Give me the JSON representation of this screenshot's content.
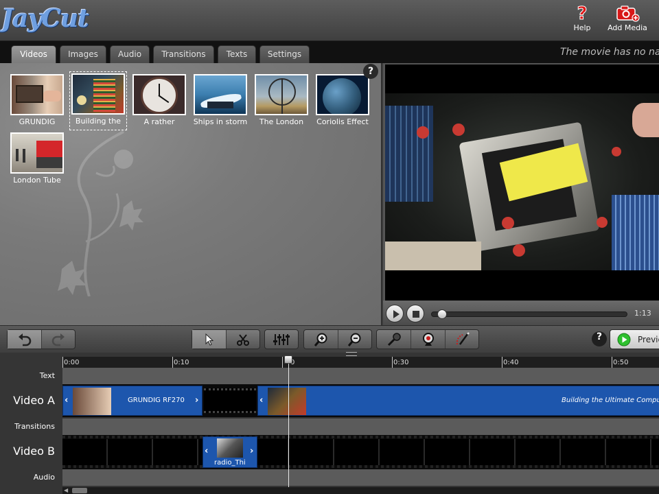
{
  "header": {
    "logo_text": "JayCut",
    "help_label": "Help",
    "add_media_label": "Add Media"
  },
  "tabs": [
    {
      "label": "Videos",
      "active": true
    },
    {
      "label": "Images",
      "active": false
    },
    {
      "label": "Audio",
      "active": false
    },
    {
      "label": "Transitions",
      "active": false
    },
    {
      "label": "Texts",
      "active": false
    },
    {
      "label": "Settings",
      "active": false
    }
  ],
  "movie_status": "The movie has no na",
  "library": {
    "help_glyph": "?",
    "clips": [
      {
        "label": "GRUNDIG",
        "selected": false
      },
      {
        "label": "Building the",
        "selected": true
      },
      {
        "label": "A rather",
        "selected": false
      },
      {
        "label": "Ships in storm",
        "selected": false
      },
      {
        "label": "The London",
        "selected": false
      },
      {
        "label": "Coriolis Effect",
        "selected": false
      },
      {
        "label": "London Tube",
        "selected": false
      }
    ]
  },
  "preview": {
    "time": "1:13",
    "progress": 0.03
  },
  "toolbar": {
    "help_glyph": "?",
    "preview_label": "Previe"
  },
  "timeline": {
    "ticks": [
      "0:00",
      "0:10",
      "0:20",
      "0:30",
      "0:40",
      "0:50"
    ],
    "visible_ticks": [
      "0:00",
      "0:10",
      "0:30",
      "0:40",
      "0:50"
    ],
    "partial_tick": "0",
    "tracks": {
      "text": "Text",
      "video_a": "Video A",
      "transitions": "Transitions",
      "video_b": "Video B",
      "audio": "Audio"
    },
    "clips_a": [
      {
        "name": "GRUNDIG RF270"
      },
      {
        "name": "Building the Ultimate Comput"
      }
    ],
    "clips_b": [
      {
        "name": "radio_Thi"
      }
    ]
  },
  "colors": {
    "clip_blue": "#1d56ad",
    "accent_play": "#2ec02e"
  }
}
